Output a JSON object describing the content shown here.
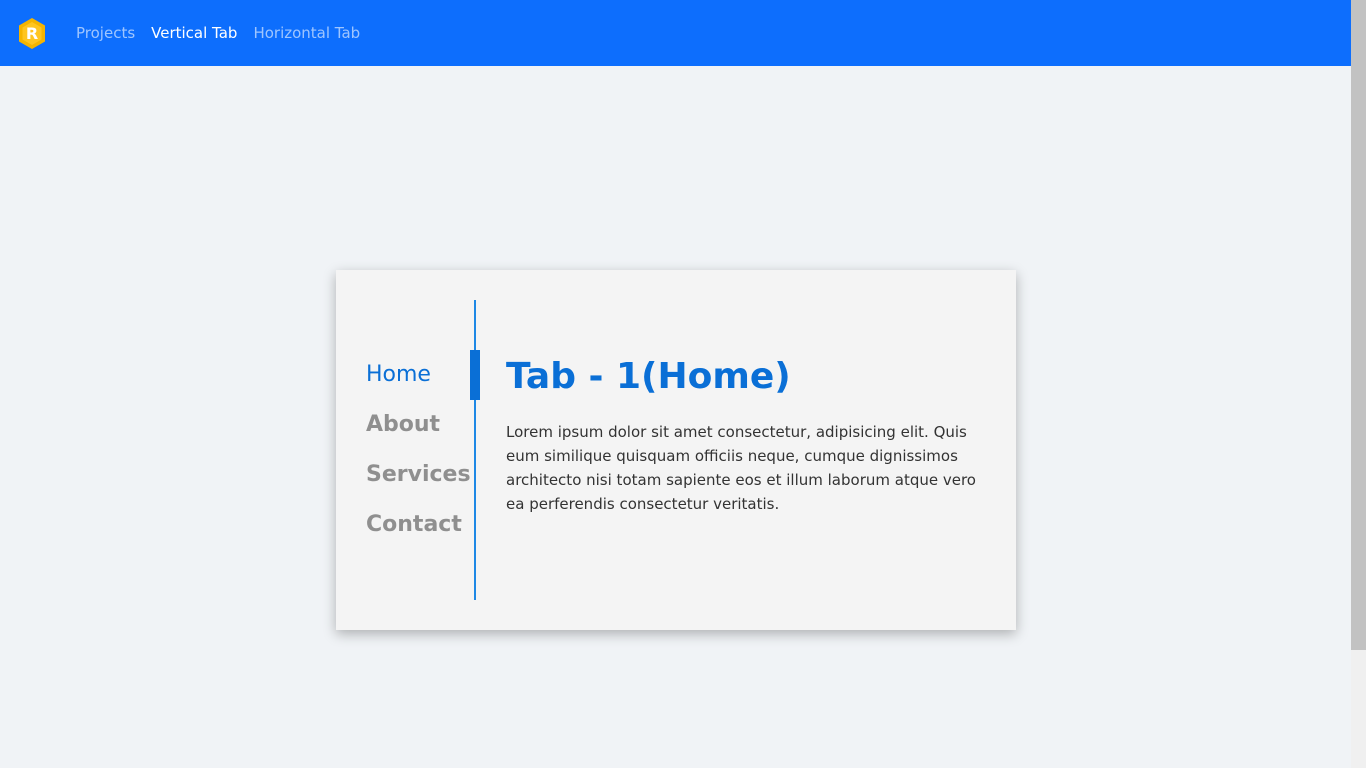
{
  "navbar": {
    "logo_letter": "R",
    "links": [
      {
        "label": "Projects"
      },
      {
        "label": "Vertical Tab"
      },
      {
        "label": "Horizontal Tab"
      }
    ],
    "active_link": "Vertical Tab"
  },
  "tabs": {
    "items": [
      {
        "label": "Home"
      },
      {
        "label": "About"
      },
      {
        "label": "Services"
      },
      {
        "label": "Contact"
      }
    ],
    "active": "Home"
  },
  "content": {
    "title": "Tab - 1(Home)",
    "body": "Lorem ipsum dolor sit amet consectetur, adipisicing elit. Quis eum similique quisquam officiis neque, cumque dignissimos architecto nisi totam sapiente eos et illum laborum atque vero ea perferendis consectetur veritatis."
  },
  "colors": {
    "navbar_bg": "#0d6efd",
    "accent": "#0a6fd6",
    "logo": "#f5b400",
    "page_bg": "#f0f3f6"
  }
}
